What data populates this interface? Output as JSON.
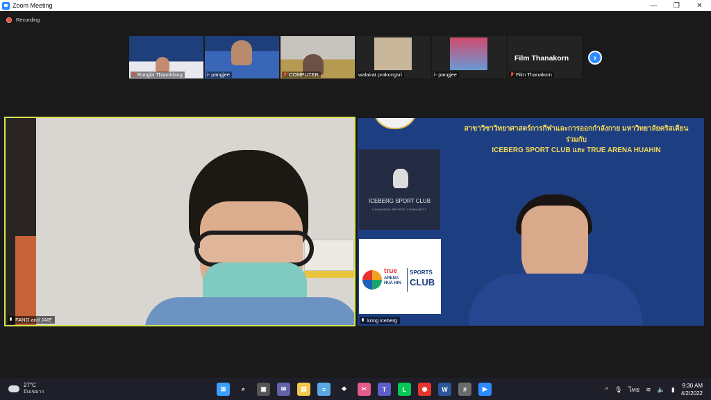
{
  "window": {
    "title": "Zoom Meeting",
    "minimize": "—",
    "restore": "❐",
    "close": "✕"
  },
  "meeting": {
    "recording_label": "Recording",
    "thumbnails": [
      {
        "name": "Rungfa Thiamklang",
        "muted": true
      },
      {
        "name": "i- pangjee",
        "muted": false
      },
      {
        "name": "COMPUTER",
        "muted": true
      },
      {
        "name": "walairat prakongsri",
        "muted": false
      },
      {
        "name": "i- pangjee",
        "muted": false
      },
      {
        "name": "Film Thanakorn",
        "muted": true,
        "display_text": "Film Thanakorn"
      }
    ],
    "next_page": "›",
    "main_left": {
      "name": "FANG and JAIE"
    },
    "main_right": {
      "name": "kong iceberg",
      "banner_line1": "สาขาวิชาวิทยาศาสตร์การกีฬาและการออกกำลังกาย มหาวิทยาลัยคริสเตียน",
      "banner_line2": "ร่วมกับ",
      "banner_line3": "ICEBERG SPORT CLUB และ TRUE ARENA HUAHIN",
      "iceberg_brand": "ICEBERG SPORT CLUB",
      "iceberg_sub": "CHIANGRAI SPORTS COMMUNITY",
      "true_t1": "true",
      "true_t2": "ARENA",
      "true_t3": "HUA HIN",
      "sports_t1": "SPORTS",
      "sports_t2": "CLUB"
    }
  },
  "taskbar": {
    "weather_temp": "27°C",
    "weather_desc": "มีเมฆมาก",
    "apps": [
      {
        "icon": "windows-start-icon",
        "color": "#3aa0ff",
        "glyph": "⊞"
      },
      {
        "icon": "search-icon",
        "color": "transparent",
        "glyph": "⌕"
      },
      {
        "icon": "task-view-icon",
        "color": "#555",
        "glyph": "▣"
      },
      {
        "icon": "teams-chat-icon",
        "color": "#6264a7",
        "glyph": "✉"
      },
      {
        "icon": "file-explorer-icon",
        "color": "#f2c94c",
        "glyph": "▤"
      },
      {
        "icon": "notepad-icon",
        "color": "#5aa9e6",
        "glyph": "≡"
      },
      {
        "icon": "dropbox-icon",
        "color": "transparent",
        "glyph": "❖"
      },
      {
        "icon": "snipping-tool-icon",
        "color": "#e65b8b",
        "glyph": "✂"
      },
      {
        "icon": "teams-icon",
        "color": "#5b5fc7",
        "glyph": "T"
      },
      {
        "icon": "line-icon",
        "color": "#06c755",
        "glyph": "L"
      },
      {
        "icon": "chrome-icon",
        "color": "#e5342d",
        "glyph": "◉"
      },
      {
        "icon": "word-icon",
        "color": "#2b579a",
        "glyph": "W"
      },
      {
        "icon": "calculator-icon",
        "color": "#6b6b6b",
        "glyph": "#"
      },
      {
        "icon": "zoom-icon",
        "color": "#2D8CFF",
        "glyph": "▶"
      }
    ],
    "tray_chevron": "^",
    "language": "ไทย",
    "time": "9:30 AM",
    "date": "4/2/2022"
  }
}
